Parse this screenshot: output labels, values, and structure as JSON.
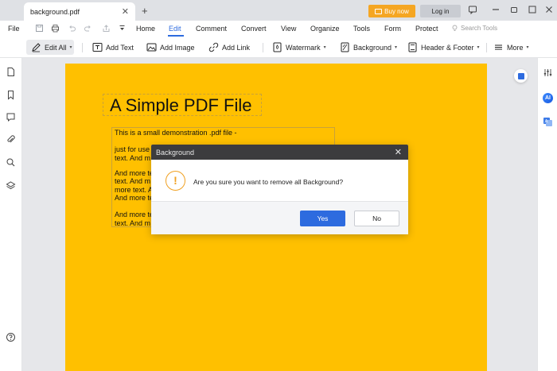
{
  "titlebar": {
    "tab_label": "background.pdf",
    "tab_close": "✕",
    "new_tab": "+",
    "buy_now": "Buy now",
    "log_in": "Log in"
  },
  "menu": {
    "file": "File",
    "items": [
      "Home",
      "Edit",
      "Comment",
      "Convert",
      "View",
      "Organize",
      "Tools",
      "Form",
      "Protect"
    ],
    "active": "Edit",
    "search_tools": "Search Tools"
  },
  "toolbar": {
    "edit_all": "Edit All",
    "add_text": "Add Text",
    "add_image": "Add Image",
    "add_link": "Add Link",
    "watermark": "Watermark",
    "background": "Background",
    "header_footer": "Header & Footer",
    "more": "More"
  },
  "document": {
    "title": "A Simple PDF File",
    "lines": [
      "This is a small demonstration .pdf file -",
      "just for use",
      "text. And m",
      "And more te",
      "text. And m",
      "more text. A",
      "And more te",
      "And more te",
      "text. And m"
    ],
    "page_color": "#ffc000"
  },
  "dialog": {
    "title": "Background",
    "close": "✕",
    "icon": "!",
    "message": "Are you sure you want to remove all Background?",
    "yes": "Yes",
    "no": "No"
  },
  "right_sidebar": {
    "ai_label": "AI"
  },
  "colors": {
    "accent": "#2d6bdf",
    "buy_now": "#f5a623",
    "warning": "#f0a020"
  }
}
